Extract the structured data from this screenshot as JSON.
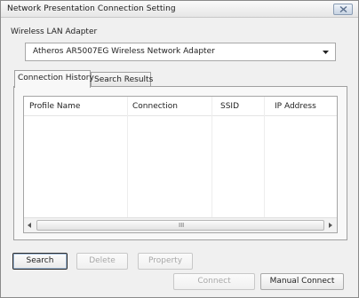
{
  "window": {
    "title": "Network Presentation Connection Setting",
    "close_label": "Close"
  },
  "adapter": {
    "label": "Wireless LAN Adapter",
    "selected": "Atheros AR5007EG Wireless Network Adapter"
  },
  "tabs": [
    {
      "label": "Connection History",
      "active": true
    },
    {
      "label": "Search Results",
      "active": false
    }
  ],
  "list": {
    "columns": [
      "Profile Name",
      "Connection",
      "SSID",
      "IP Address"
    ],
    "rows": [],
    "scroll_grip": "III"
  },
  "buttons": {
    "search": "Search",
    "delete": "Delete",
    "property": "Property",
    "connect": "Connect",
    "manual_connect": "Manual Connect"
  },
  "colors": {
    "window_bg": "#f0f0f0",
    "close_button": "#c7d3e2",
    "disabled_text": "#a8a8a8"
  },
  "icons": {
    "close": "close-icon",
    "dropdown": "chevron-down-icon",
    "scroll_left": "scroll-left-arrow-icon",
    "scroll_right": "scroll-right-arrow-icon"
  }
}
